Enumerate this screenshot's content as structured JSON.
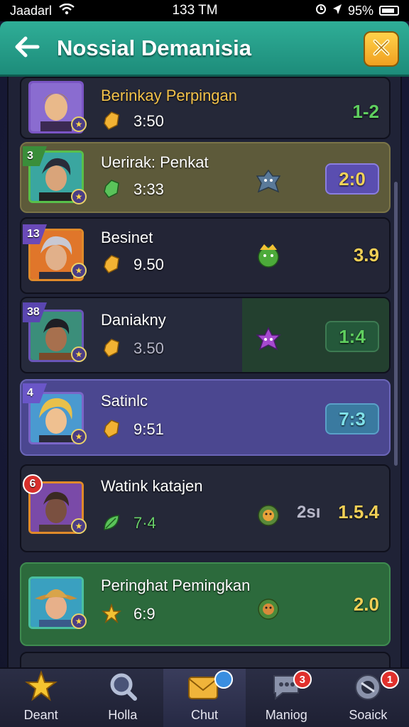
{
  "status_bar": {
    "carrier": "Jaadarl",
    "time": "133 TM",
    "battery": "95%"
  },
  "header": {
    "title": "Nossial Demanisia"
  },
  "rows": [
    {
      "rank": "",
      "name": "Berinkay Perpingan",
      "time": "3:50",
      "score": "1-2",
      "colors": {
        "score": "#5fcf5f",
        "gem": "#f2b233"
      }
    },
    {
      "rank": "3",
      "name": "Uerirak: Penkat",
      "time": "3:33",
      "score": "2:0",
      "colors": {
        "score": "#f2d25a",
        "gem": "#5ac35a"
      }
    },
    {
      "rank": "13",
      "name": "Besinet",
      "time": "9.50",
      "score": "3.9",
      "colors": {
        "score": "#f0cf56",
        "gem": "#f2b233"
      }
    },
    {
      "rank": "38",
      "name": "Daniakny",
      "time": "3.50",
      "score": "1:4",
      "colors": {
        "score": "#5fcf5f",
        "gem": "#f2b233"
      }
    },
    {
      "rank": "4",
      "name": "Satinlc",
      "time": "9:51",
      "score": "7:3",
      "colors": {
        "score": "#7fe0e8",
        "gem": "#f2b233"
      }
    },
    {
      "rank": "6",
      "name": "Watink katajen",
      "time": "7·4",
      "pre_score": "2sı",
      "score": "1.5.4",
      "colors": {
        "score": "#f0cf56",
        "gem": "#5ac35a"
      }
    },
    {
      "rank": "",
      "name": "Peringhat Pemingkan",
      "time": "6:9",
      "score": "2.0",
      "colors": {
        "score": "#f0cf56",
        "gem": "#f2c233"
      }
    }
  ],
  "nav": {
    "items": [
      {
        "label": "Deant",
        "icon": "star-icon",
        "badge": ""
      },
      {
        "label": "Holla",
        "icon": "search-icon",
        "badge": ""
      },
      {
        "label": "Chut",
        "icon": "chat-icon",
        "badge": ""
      },
      {
        "label": "Maniog",
        "icon": "message-icon",
        "badge": "3"
      },
      {
        "label": "Soaick",
        "icon": "controller-icon",
        "badge": "1"
      }
    ]
  }
}
